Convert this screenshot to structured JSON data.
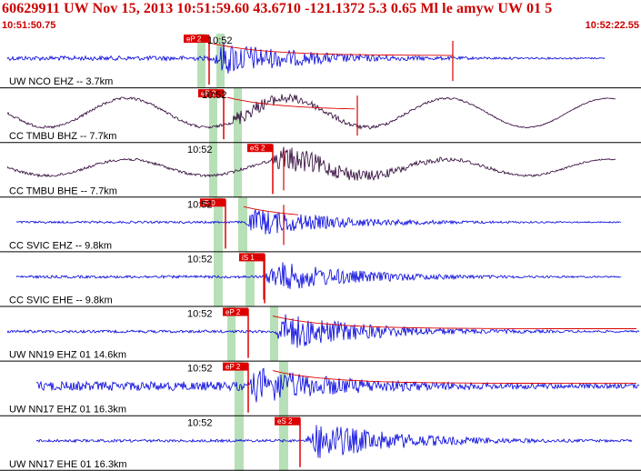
{
  "header": {
    "title": "60629911 UW Nov 15, 2013 10:51:59.60   43.6710 -121.1372  5.3 0.65 Ml le amyw UW 01   5",
    "start_time": "10:51:50.75",
    "end_time": "10:52:22.55"
  },
  "colors": {
    "background": "#ffffff",
    "trace_blue": "#0000dd",
    "trace_dark": "#2a0033",
    "pick_red": "#dd0000",
    "window_green": "#b8e0b8",
    "text_red": "#cc0000"
  },
  "traces": [
    {
      "label": "UW NCO EHZ -- 3.7km",
      "tick": "10:52",
      "pick": "eP 2",
      "color": "blue"
    },
    {
      "label": "CC TMBU BHZ -- 7.7km",
      "tick": "10:52",
      "pick": "eP 2",
      "color": "dark"
    },
    {
      "label": "CC TMBU BHE -- 7.7km",
      "tick": "10:52",
      "pick": "eS 2",
      "color": "dark"
    },
    {
      "label": "CC SVIC EHZ -- 9.8km",
      "tick": "10:52",
      "pick": "iP 0",
      "color": "blue"
    },
    {
      "label": "CC SVIC EHE -- 9.8km",
      "tick": "10:52",
      "pick": "iS 1",
      "color": "blue"
    },
    {
      "label": "UW NN19 EHZ 01 14.6km",
      "tick": "10:52",
      "pick": "eP 2",
      "color": "blue"
    },
    {
      "label": "UW NN17 EHZ 01 16.3km",
      "tick": "10:52",
      "pick": "eP 2",
      "color": "blue"
    },
    {
      "label": "UW NN17 EHE 01 16.3km",
      "tick": "10:52",
      "pick": "eS 2",
      "color": "blue"
    }
  ]
}
